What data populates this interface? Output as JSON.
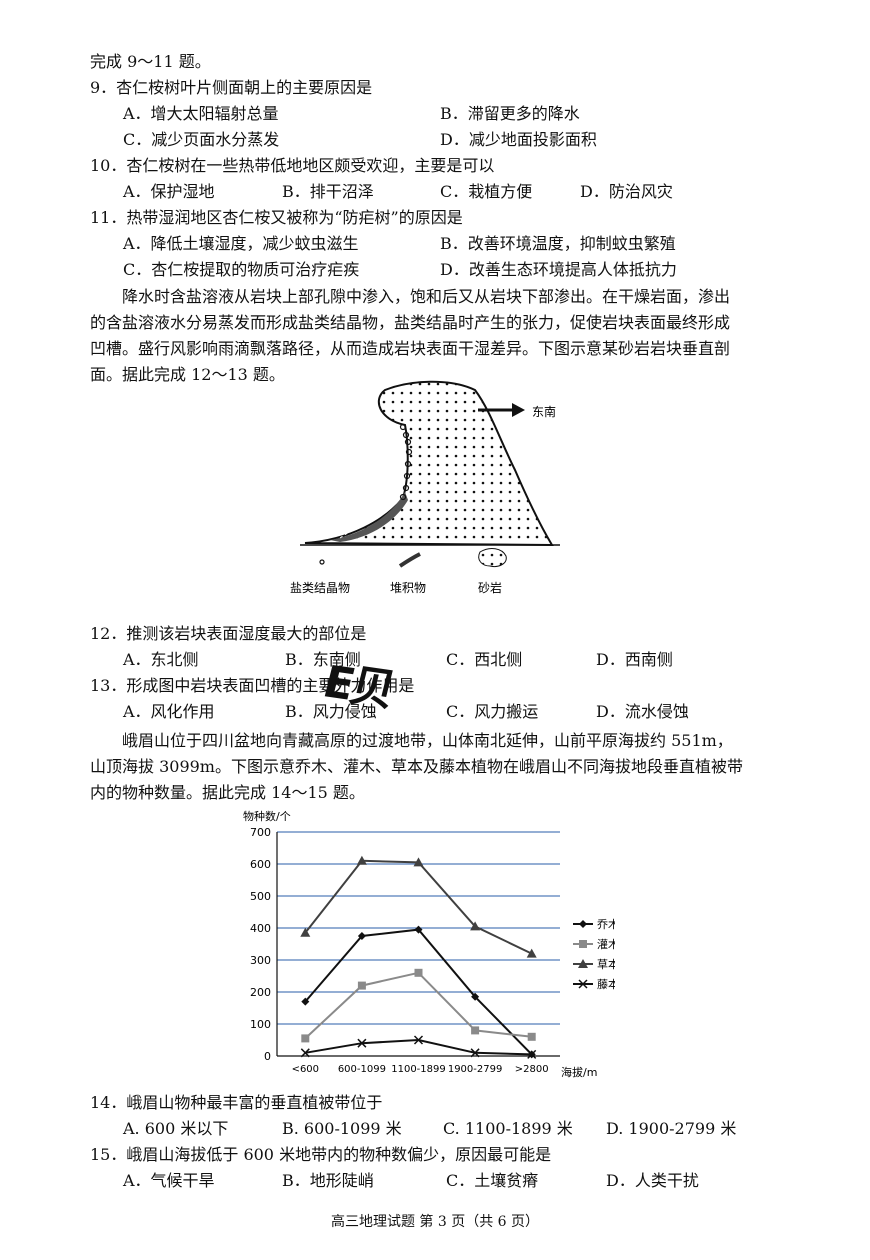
{
  "intro_top": "完成 9～11 题。",
  "q9": {
    "stem": "9．杏仁桉树叶片侧面朝上的主要原因是",
    "a": "A．增大太阳辐射总量",
    "b": "B．滞留更多的降水",
    "c": "C．减少页面水分蒸发",
    "d": "D．减少地面投影面积"
  },
  "q10": {
    "stem": "10．杏仁桉树在一些热带低地地区颇受欢迎，主要是可以",
    "a": "A．保护湿地",
    "b": "B．排干沼泽",
    "c": "C．栽植方便",
    "d": "D．防治风灾"
  },
  "q11": {
    "stem": "11．热带湿润地区杏仁桉又被称为“防疟树”的原因是",
    "a": "A．降低土壤湿度，减少蚊虫滋生",
    "b": "B．改善环境温度，抑制蚊虫繁殖",
    "c": "C．杏仁桉提取的物质可治疗疟疾",
    "d": "D．改善生态环境提高人体抵抗力"
  },
  "para1": [
    "降水时含盐溶液从岩块上部孔隙中渗入，饱和后又从岩块下部渗出。在干燥岩面，渗出",
    "的含盐溶液水分易蒸发而形成盐类结晶物，盐类结晶时产生的张力，促使岩块表面最终形成",
    "凹槽。盛行风影响雨滴飘落路径，从而造成岩块表面干湿差异。下图示意某砂岩岩块垂直剖",
    "面。据此完成 12～13 题。"
  ],
  "rock_figure": {
    "direction": "东南",
    "legend": [
      "盐类结晶物",
      "堆积物",
      "砂岩"
    ]
  },
  "q12": {
    "stem": "12．推测该岩块表面湿度最大的部位是",
    "a": "A．东北侧",
    "b": "B．东南侧",
    "c": "C．西北侧",
    "d": "D．西南侧"
  },
  "q13": {
    "stem": "13．形成图中岩块表面凹槽的主要外力作用是",
    "a": "A．风化作用",
    "b": "B．风力侵蚀",
    "c": "C．风力搬运",
    "d": "D．流水侵蚀"
  },
  "stamp_text": "E贝",
  "para2": [
    "峨眉山位于四川盆地向青藏高原的过渡地带，山体南北延伸，山前平原海拔约 551m，",
    "山顶海拔 3099m。下图示意乔木、灌木、草本及藤本植物在峨眉山不同海拔地段垂直植被带",
    "内的物种数量。据此完成 14～15 题。"
  ],
  "chart_data": {
    "type": "line",
    "ylabel": "物种数/个",
    "xlabel": "海拔/m",
    "categories": [
      "<600",
      "600-1099",
      "1100-1899",
      "1900-2799",
      ">2800"
    ],
    "ylim": [
      0,
      700
    ],
    "yticks": [
      0,
      100,
      200,
      300,
      400,
      500,
      600,
      700
    ],
    "grid": true,
    "legend_position": "right",
    "series": [
      {
        "name": "乔木",
        "marker": "diamond",
        "color": "#111111",
        "values": [
          170,
          375,
          395,
          185,
          5
        ]
      },
      {
        "name": "灌木",
        "marker": "square",
        "color": "#8a8a8a",
        "values": [
          55,
          220,
          260,
          80,
          60
        ]
      },
      {
        "name": "草本",
        "marker": "triangle",
        "color": "#404040",
        "values": [
          385,
          610,
          605,
          405,
          320
        ]
      },
      {
        "name": "藤本",
        "marker": "x",
        "color": "#111111",
        "values": [
          10,
          40,
          50,
          10,
          5
        ]
      }
    ]
  },
  "q14": {
    "stem": "14．峨眉山物种最丰富的垂直植被带位于",
    "a": "A. 600 米以下",
    "b": "B. 600-1099 米",
    "c": "C. 1100-1899 米",
    "d": "D. 1900-2799 米"
  },
  "q15": {
    "stem": "15．峨眉山海拔低于 600 米地带内的物种数偏少，原因最可能是",
    "a": "A．气候干旱",
    "b": "B．地形陡峭",
    "c": "C．土壤贫瘠",
    "d": "D．人类干扰"
  },
  "footer": "高三地理试题   第 3 页（共 6 页）"
}
